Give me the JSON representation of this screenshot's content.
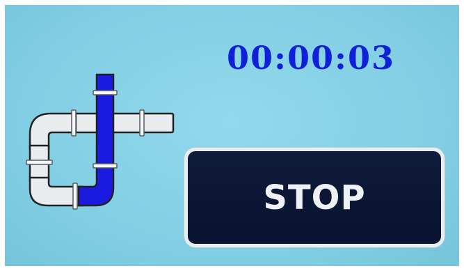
{
  "timer": {
    "elapsed": "00:00:03"
  },
  "stop_button": {
    "label": "STOP"
  },
  "pipe_graphic": {
    "icon": "pipe-flow-icon",
    "flow_path": "vertical-then-bottom-horizontal"
  },
  "colors": {
    "background": "#86d1e8",
    "timer_text": "#1020d8",
    "pipe_fill": "#e9ecef",
    "pipe_outline": "#222222",
    "flow_fill": "#1a1ae0",
    "button_fill": "#0b1633",
    "button_border": "#e7eef2",
    "button_text": "#eef2f5"
  }
}
